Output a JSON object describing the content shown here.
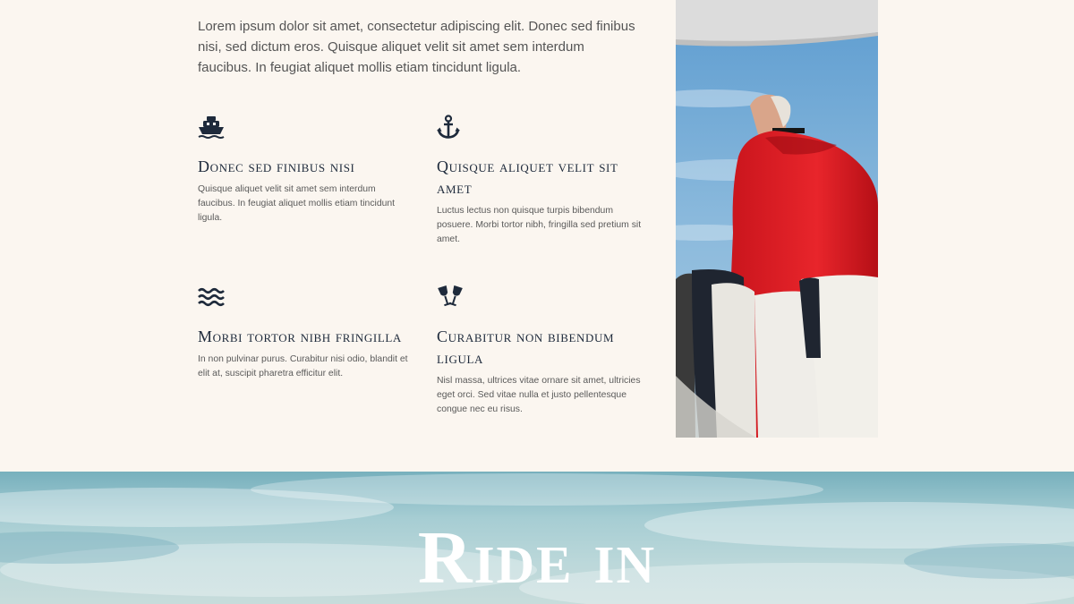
{
  "intro": {
    "text": "Lorem ipsum dolor sit amet, consectetur adipiscing elit. Donec sed finibus nisi, sed dictum eros. Quisque aliquet velit sit amet sem interdum faucibus. In feugiat aliquet mollis etiam tincidunt ligula."
  },
  "features": [
    {
      "icon": "ship-icon",
      "title": "Donec sed finibus nisi",
      "text": "Quisque aliquet velit sit amet sem interdum faucibus. In feugiat aliquet mollis etiam tincidunt ligula."
    },
    {
      "icon": "anchor-icon",
      "title": "Quisque aliquet velit sit amet",
      "text": "Luctus lectus non quisque turpis bibendum posuere. Morbi tortor nibh, fringilla sed pretium sit amet."
    },
    {
      "icon": "water-waves-icon",
      "title": "Morbi tortor nibh fringilla",
      "text": "In non pulvinar purus. Curabitur nisi odio, blandit et elit at, suscipit pharetra efficitur elit."
    },
    {
      "icon": "wine-glasses-icon",
      "title": "Curabitur non bibendum ligula",
      "text": "Nisl massa, ultrices vitae ornare sit amet, ultricies eget orci. Sed vitae nulla et justo pellentesque congue nec eu risus."
    }
  ],
  "banner": {
    "title": "Ride in"
  },
  "colors": {
    "background": "#fbf6f0",
    "heading": "#1e2a3b",
    "body_text": "#555555",
    "icon": "#1e2a3b",
    "banner_sky": "#a6cdd3"
  }
}
